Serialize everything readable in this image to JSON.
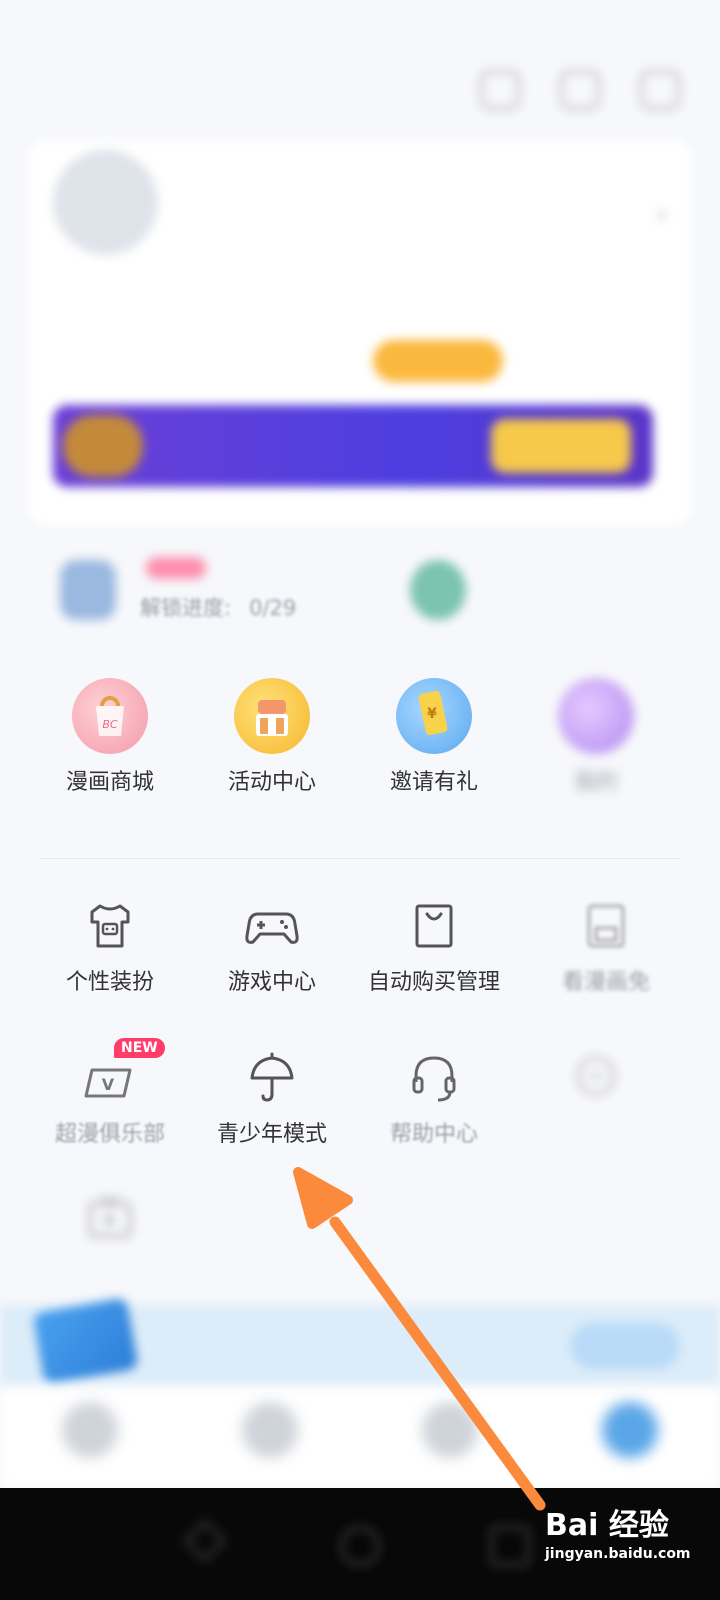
{
  "status_bar": {
    "left": "",
    "right": ""
  },
  "profile": {
    "username": "",
    "subtitle": "",
    "stats": [
      {
        "label": "",
        "value": ""
      },
      {
        "label": "",
        "value": ""
      },
      {
        "label": "",
        "value": ""
      }
    ],
    "vip_banner_text": "",
    "vip_button": ""
  },
  "mini_row": {
    "left": {
      "title": "",
      "sub_label": "解锁进度:",
      "sub_value": "0/29"
    },
    "right": {
      "title": "",
      "sub": ""
    }
  },
  "feature_rows": [
    [
      {
        "label": "漫画商城",
        "icon": "shopping-bag-icon"
      },
      {
        "label": "活动中心",
        "icon": "activity-gift-icon"
      },
      {
        "label": "邀请有礼",
        "icon": "invite-coupon-icon"
      },
      {
        "label": "我的",
        "icon": "my-item-icon",
        "faded": true
      }
    ],
    [
      {
        "label": "个性装扮",
        "icon": "tshirt-icon"
      },
      {
        "label": "游戏中心",
        "icon": "gamepad-icon"
      },
      {
        "label": "自动购买管理",
        "icon": "shopping-bag-outline-icon"
      },
      {
        "label": "看漫画免",
        "icon": "save-disk-icon",
        "faded": true
      }
    ],
    [
      {
        "label": "超漫俱乐部",
        "icon": "vip-club-icon",
        "badge": "NEW",
        "faded": true
      },
      {
        "label": "青少年模式",
        "icon": "umbrella-icon"
      },
      {
        "label": "帮助中心",
        "icon": "headset-icon",
        "faded": true
      },
      {
        "label": "",
        "icon": "message-bubble-icon",
        "faded": true
      }
    ],
    [
      {
        "label": "",
        "icon": "tv-play-icon",
        "faded": true
      }
    ]
  ],
  "bottom_banner": {
    "text": ""
  },
  "tab_bar": [
    {
      "label": ""
    },
    {
      "label": ""
    },
    {
      "label": ""
    },
    {
      "label": ""
    }
  ],
  "watermark": {
    "main": "Bai 经验",
    "url": "jingyan.baidu.com"
  },
  "colors": {
    "accent_orange": "#fb8a3c",
    "vip_purple": "#5a3de0",
    "new_badge": "#ff3d6b"
  }
}
